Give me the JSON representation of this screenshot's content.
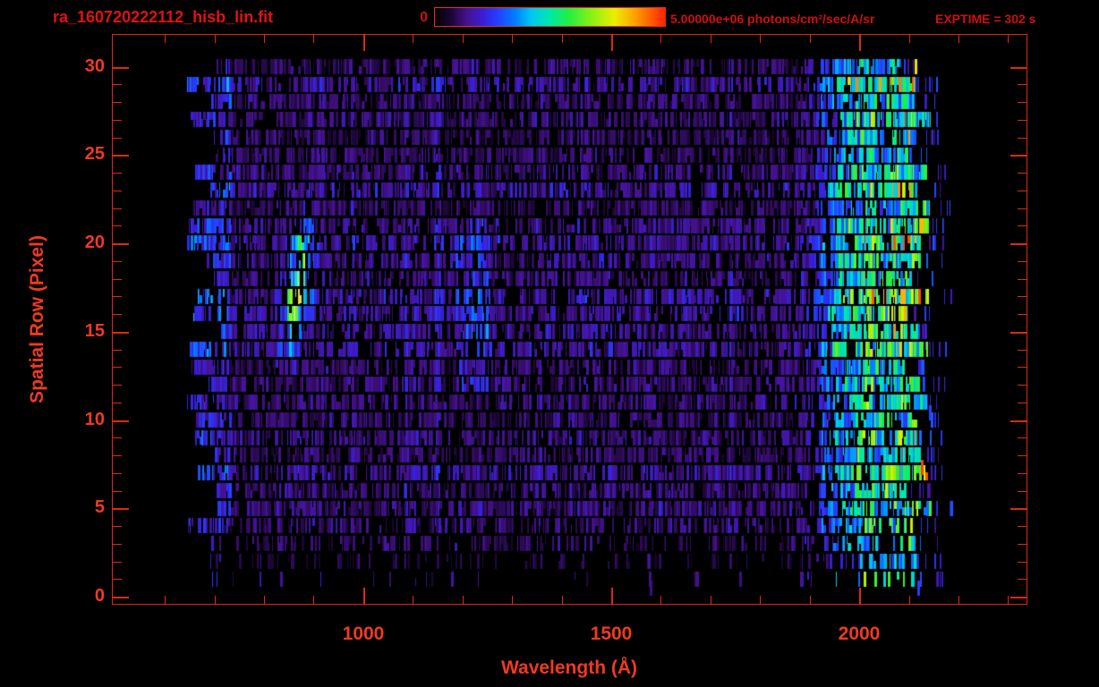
{
  "header": {
    "title": "ra_160720222112_hisb_lin.fit",
    "exptime": "EXPTIME = 302 s",
    "colorbar": {
      "min_label": "0",
      "max_label": "5.00000e+06 photons/cm²/sec/A/sr"
    }
  },
  "chart_data": {
    "type": "heatmap",
    "title": "ra_160720222112_hisb_lin.fit",
    "xlabel": "Wavelength (Å)",
    "ylabel": "Spatial Row (Pixel)",
    "x_range": [
      495,
      2337
    ],
    "y_range": [
      -0.45,
      31.8
    ],
    "x_major_ticks": [
      1000,
      1500,
      2000
    ],
    "x_minor_tick_step": 100,
    "y_major_ticks": [
      0,
      5,
      10,
      15,
      20,
      25,
      30
    ],
    "y_minor_tick_step": 1,
    "grid": false,
    "legend": "colorbar-top",
    "exposure_seconds": 302,
    "colorbar": {
      "min": 0,
      "max": 5000000,
      "units": "photons/cm²/sec/A/sr",
      "palette": "rainbow",
      "palette_stops": [
        {
          "t": 0.0,
          "c": "#000000"
        },
        {
          "t": 0.07,
          "c": "#1c0636"
        },
        {
          "t": 0.14,
          "c": "#45128f"
        },
        {
          "t": 0.21,
          "c": "#3a1ed8"
        },
        {
          "t": 0.28,
          "c": "#2244ff"
        },
        {
          "t": 0.35,
          "c": "#0080ff"
        },
        {
          "t": 0.42,
          "c": "#00c8f0"
        },
        {
          "t": 0.5,
          "c": "#00e8a8"
        },
        {
          "t": 0.58,
          "c": "#22ee44"
        },
        {
          "t": 0.68,
          "c": "#8af014"
        },
        {
          "t": 0.78,
          "c": "#eaee00"
        },
        {
          "t": 0.87,
          "c": "#ffa000"
        },
        {
          "t": 1.0,
          "c": "#ff2000"
        }
      ]
    },
    "data": {
      "wavelength_extent": [
        668,
        2108
      ],
      "row_extent": [
        1,
        30
      ],
      "background_flux_fraction": [
        0.05,
        0.2
      ],
      "features": [
        {
          "name": "bright-streak",
          "rows": [
            13,
            22
          ],
          "wavelength_center_row17": 864,
          "tilt_A_per_row": 4.2,
          "sigma_A": 15,
          "peak_fraction": 0.5,
          "description": "bright blue emission streak near 860 Å, rows 14-21"
        },
        {
          "name": "long-wavelength-emission-band",
          "wavelength": [
            1870,
            2150
          ],
          "peak_fraction": 0.55,
          "description": "green/cyan bright band at red end of spectrum"
        },
        {
          "name": "left-edge-blue-column",
          "wavelength": [
            668,
            730
          ],
          "peak_fraction": 0.3
        },
        {
          "name": "mid-blue-column",
          "wavelength": [
            1185,
            1248
          ],
          "rows": [
            12,
            21
          ],
          "peak_fraction": 0.28
        },
        {
          "name": "sparse-bottom-rows",
          "rows": [
            1,
            4
          ]
        }
      ],
      "notable_points": [
        {
          "row": 30,
          "wavelength": 2112,
          "value_fraction": 0.8
        },
        {
          "row": 7.3,
          "wavelength": 2124,
          "value_fraction": 0.97
        },
        {
          "row": 10.4,
          "wavelength": 2140,
          "value_fraction": 0.28
        },
        {
          "row": 0.5,
          "wavelength": 1578,
          "value_fraction": 0.13
        },
        {
          "row": 0.5,
          "wavelength": 2116,
          "value_fraction": 0.27
        }
      ]
    },
    "colors": {
      "frame": "#da2b15",
      "tick_labels": "#ef3a22",
      "header_text": "#cf1010",
      "title_text": "#e01212",
      "background": "#000000"
    }
  }
}
